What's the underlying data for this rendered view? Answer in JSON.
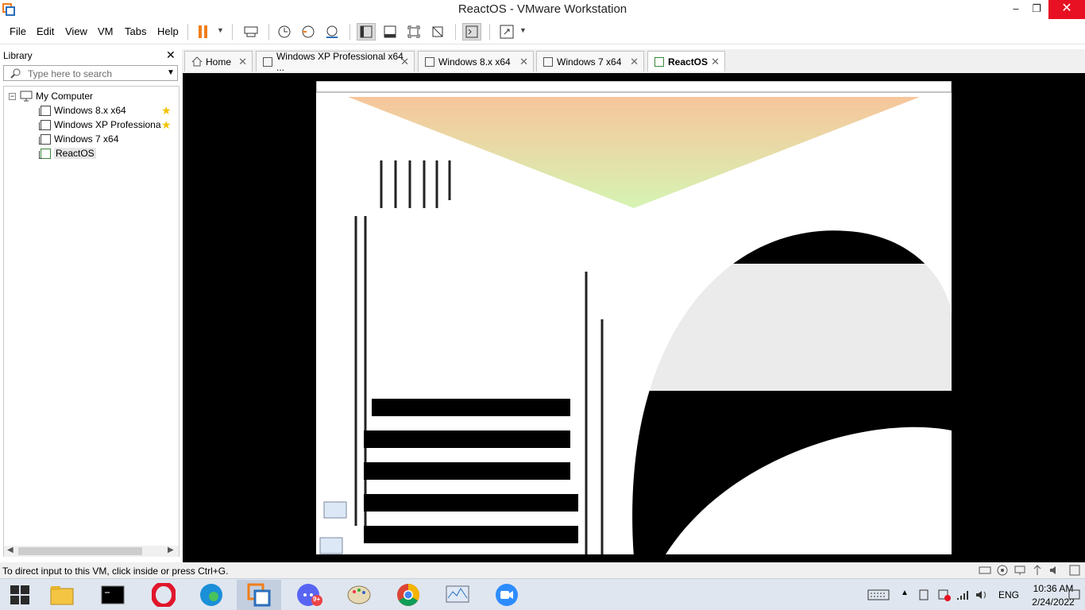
{
  "window": {
    "title": "ReactOS - VMware Workstation",
    "minimize": "–",
    "maximize": "❐",
    "close": "✕"
  },
  "menu": [
    "File",
    "Edit",
    "View",
    "VM",
    "Tabs",
    "Help"
  ],
  "library": {
    "title": "Library",
    "close": "✕",
    "search_placeholder": "Type here to search",
    "tree": {
      "root": "My Computer",
      "items": [
        {
          "label": "Windows 8.x x64",
          "favorite": true
        },
        {
          "label": "Windows XP Professiona",
          "favorite": true
        },
        {
          "label": "Windows 7 x64",
          "favorite": false
        },
        {
          "label": "ReactOS",
          "favorite": false,
          "running": true
        }
      ]
    }
  },
  "tabs": [
    {
      "label": "Home"
    },
    {
      "label": "Windows XP Professional x64 ..."
    },
    {
      "label": "Windows 8.x x64"
    },
    {
      "label": "Windows 7 x64"
    },
    {
      "label": "ReactOS",
      "active": true
    }
  ],
  "status": {
    "text": "To direct input to this VM, click inside or press Ctrl+G."
  },
  "taskbar": {
    "apps": [
      "windows-start",
      "file-explorer",
      "command-prompt",
      "opera",
      "edge",
      "vmware",
      "discord",
      "paint",
      "chrome",
      "performance-monitor",
      "zoom"
    ],
    "discord_badge": "9+",
    "language": "ENG",
    "time": "10:36 AM",
    "date": "2/24/2022"
  },
  "colors": {
    "accent_orange": "#f07d1a",
    "close_red": "#e81123",
    "taskbar_bg": "#dfe6ef"
  }
}
